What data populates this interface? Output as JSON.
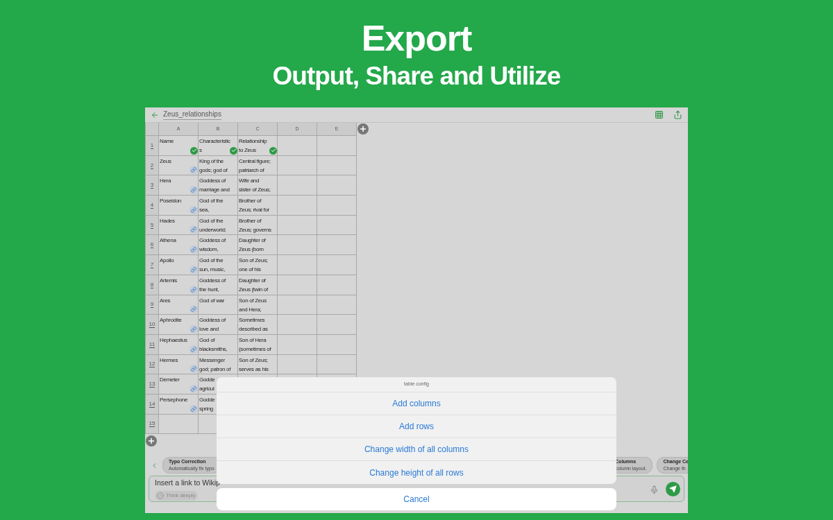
{
  "hero": {
    "title": "Export",
    "subtitle": "Output, Share and Utilize"
  },
  "app": {
    "file_name": "Zeus_relationships",
    "columns": [
      "A",
      "B",
      "C",
      "D",
      "E"
    ],
    "rows": [
      {
        "number": "1",
        "cells": [
          {
            "lines": [
              "Name"
            ],
            "kind": "check"
          },
          {
            "lines": [
              "Characteristic",
              "s"
            ],
            "kind": "check"
          },
          {
            "lines": [
              "Relationship",
              "to Zeus"
            ],
            "kind": "check"
          }
        ]
      },
      {
        "number": "2",
        "cells": [
          {
            "lines": [
              "Zeus"
            ],
            "kind": "link"
          },
          {
            "lines": [
              "King of the",
              "gods; god of"
            ]
          },
          {
            "lines": [
              "Central figure;",
              "patriarch of"
            ]
          }
        ]
      },
      {
        "number": "3",
        "cells": [
          {
            "lines": [
              "Hera"
            ],
            "kind": "link"
          },
          {
            "lines": [
              "Goddess of",
              "marriage and"
            ]
          },
          {
            "lines": [
              "Wife and",
              "sister of Zeus;"
            ]
          }
        ]
      },
      {
        "number": "4",
        "cells": [
          {
            "lines": [
              "Poseidon"
            ],
            "kind": "link"
          },
          {
            "lines": [
              "God of the",
              "sea,"
            ]
          },
          {
            "lines": [
              "Brother of",
              "Zeus; rival for"
            ]
          }
        ]
      },
      {
        "number": "5",
        "cells": [
          {
            "lines": [
              "Hades"
            ],
            "kind": "link"
          },
          {
            "lines": [
              "God of the",
              "underworld;"
            ]
          },
          {
            "lines": [
              "Brother of",
              "Zeus; governs"
            ]
          }
        ]
      },
      {
        "number": "6",
        "cells": [
          {
            "lines": [
              "Athena"
            ],
            "kind": "link"
          },
          {
            "lines": [
              "Goddess of",
              "wisdom,"
            ]
          },
          {
            "lines": [
              "Daughter of",
              "Zeus (born"
            ]
          }
        ]
      },
      {
        "number": "7",
        "cells": [
          {
            "lines": [
              "Apollo"
            ],
            "kind": "link"
          },
          {
            "lines": [
              "God of the",
              "sun, music,"
            ]
          },
          {
            "lines": [
              "Son of Zeus;",
              "one of his"
            ]
          }
        ]
      },
      {
        "number": "8",
        "cells": [
          {
            "lines": [
              "Artemis"
            ],
            "kind": "link"
          },
          {
            "lines": [
              "Goddess of",
              "the hunt,"
            ]
          },
          {
            "lines": [
              "Daughter of",
              "Zeus (twin of"
            ]
          }
        ]
      },
      {
        "number": "9",
        "cells": [
          {
            "lines": [
              "Ares"
            ],
            "kind": "link"
          },
          {
            "lines": [
              "God of war"
            ]
          },
          {
            "lines": [
              "Son of Zeus",
              "and Hera;"
            ]
          }
        ]
      },
      {
        "number": "10",
        "cells": [
          {
            "lines": [
              "Aphrodite"
            ],
            "kind": "link"
          },
          {
            "lines": [
              "Goddess of",
              "love and"
            ]
          },
          {
            "lines": [
              "Sometimes",
              "described as"
            ]
          }
        ]
      },
      {
        "number": "11",
        "cells": [
          {
            "lines": [
              "Hephaestus"
            ],
            "kind": "link"
          },
          {
            "lines": [
              "God of",
              "blacksmiths,"
            ]
          },
          {
            "lines": [
              "Son of Hera",
              "(sometimes of"
            ]
          }
        ]
      },
      {
        "number": "12",
        "cells": [
          {
            "lines": [
              "Hermes"
            ],
            "kind": "link"
          },
          {
            "lines": [
              "Messenger",
              "god; patron of"
            ]
          },
          {
            "lines": [
              "Son of Zeus;",
              "serves as his"
            ]
          }
        ]
      },
      {
        "number": "13",
        "cells": [
          {
            "lines": [
              "Demeter"
            ],
            "kind": "link"
          },
          {
            "lines": [
              "Godde",
              "agricul"
            ]
          }
        ]
      },
      {
        "number": "14",
        "cells": [
          {
            "lines": [
              "Persephone"
            ],
            "kind": "link"
          },
          {
            "lines": [
              "Godde",
              "spring"
            ]
          }
        ]
      },
      {
        "number": "15"
      }
    ],
    "suggestions_start": [
      {
        "title": "Typo Correction",
        "description": "Automatically fix typo"
      }
    ],
    "suggestions_end": [
      {
        "title": "Columns",
        "description": "column layout."
      },
      {
        "title": "Change Ce",
        "description": "Change th"
      }
    ],
    "prompt": {
      "value": "Insert a link to Wikip",
      "toggle": "Think deeply"
    }
  },
  "dialog": {
    "title": "table config",
    "options": [
      "Add columns",
      "Add rows",
      "Change width of all columns",
      "Change height of all rows"
    ],
    "cancel": "Cancel"
  }
}
